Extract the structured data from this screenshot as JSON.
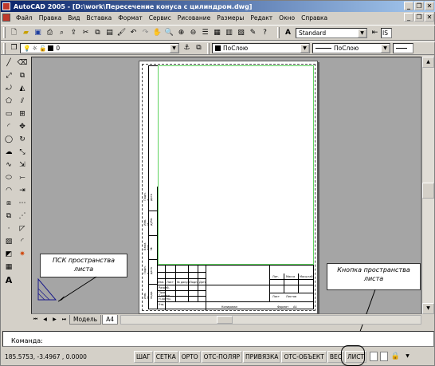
{
  "window": {
    "title": "AutoCAD 2005 - [D:\\work\\Пересечение конуса с цилиндром.dwg]"
  },
  "menu": {
    "items": [
      "Файл",
      "Правка",
      "Вид",
      "Вставка",
      "Формат",
      "Сервис",
      "Рисование",
      "Размеры",
      "Редакт",
      "Окно",
      "Справка"
    ]
  },
  "toolbar": {
    "text_style": "Standard",
    "text_style_extra": "IS",
    "layer": "0",
    "color": "ПоСлою",
    "linetype": "ПоСлою"
  },
  "sheet_stamp": {
    "cells": [
      "Лит.",
      "Масса",
      "Масштаб",
      "Изм.",
      "Лист",
      "№ докум.",
      "Подп.",
      "Дата",
      "Разраб.",
      "Пров.",
      "Т.контр.",
      "Н.контр.",
      "Утв.",
      "Лист",
      "Листов",
      "Копировал",
      "Формат",
      "А4"
    ],
    "side_labels": [
      "Инв. № подл.",
      "Подп. и дата",
      "Взам. инв. №",
      "Инв. № дубл.",
      "Подп. и дата"
    ]
  },
  "callouts": {
    "ucs_label": "ПСК пространства листа",
    "paper_button_label": "Кнопка пространства листа"
  },
  "tabs": {
    "items": [
      "Модель",
      "A4"
    ],
    "active": "A4"
  },
  "command_line": {
    "prompt": "Команда:"
  },
  "status": {
    "coordinates": "185.5753, -3.4967 , 0.0000",
    "toggles": [
      "ШАГ",
      "СЕТКА",
      "ОРТО",
      "ОТС-ПОЛЯР",
      "ПРИВЯЗКА",
      "ОТС-ОБЪЕКТ",
      "ВЕС",
      "ЛИСТ"
    ]
  }
}
